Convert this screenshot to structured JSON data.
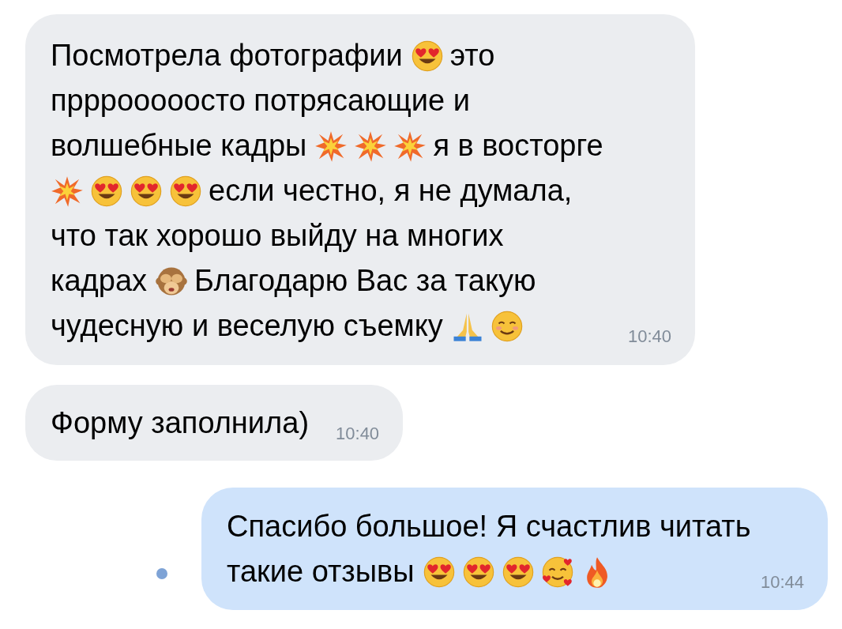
{
  "messages": [
    {
      "outgoing": false,
      "time": "10:40",
      "lines": [
        [
          {
            "kind": "text",
            "text": "Посмотрела фотографии"
          },
          {
            "kind": "heart-eyes"
          },
          {
            "kind": "text",
            "text": "это"
          }
        ],
        [
          {
            "kind": "text",
            "text": "прррооооосто потрясающие и"
          }
        ],
        [
          {
            "kind": "text",
            "text": "волшебные кадры"
          },
          {
            "kind": "collision"
          },
          {
            "kind": "collision"
          },
          {
            "kind": "collision"
          },
          {
            "kind": "text",
            "text": "я в восторге"
          }
        ],
        [
          {
            "kind": "collision"
          },
          {
            "kind": "heart-eyes"
          },
          {
            "kind": "heart-eyes"
          },
          {
            "kind": "heart-eyes"
          },
          {
            "kind": "text",
            "text": "если честно, я не думала,"
          }
        ],
        [
          {
            "kind": "text",
            "text": "что так хорошо выйду на многих"
          }
        ],
        [
          {
            "kind": "text",
            "text": "кадрах"
          },
          {
            "kind": "monkey"
          },
          {
            "kind": "text",
            "text": "Благодарю Вас за такую"
          }
        ],
        [
          {
            "kind": "text",
            "text": "чудесную и веселую съемку"
          },
          {
            "kind": "pray"
          },
          {
            "kind": "blush"
          }
        ]
      ]
    },
    {
      "outgoing": false,
      "time": "10:40",
      "lines": [
        [
          {
            "kind": "text",
            "text": "Форму заполнила)"
          }
        ]
      ]
    },
    {
      "outgoing": true,
      "time": "10:44",
      "unread": true,
      "lines": [
        [
          {
            "kind": "text",
            "text": "Спасибо большое! Я счастлив читать"
          }
        ],
        [
          {
            "kind": "text",
            "text": "такие отзывы"
          },
          {
            "kind": "heart-eyes"
          },
          {
            "kind": "heart-eyes"
          },
          {
            "kind": "heart-eyes"
          },
          {
            "kind": "hearts-face"
          },
          {
            "kind": "fire"
          }
        ]
      ]
    }
  ]
}
